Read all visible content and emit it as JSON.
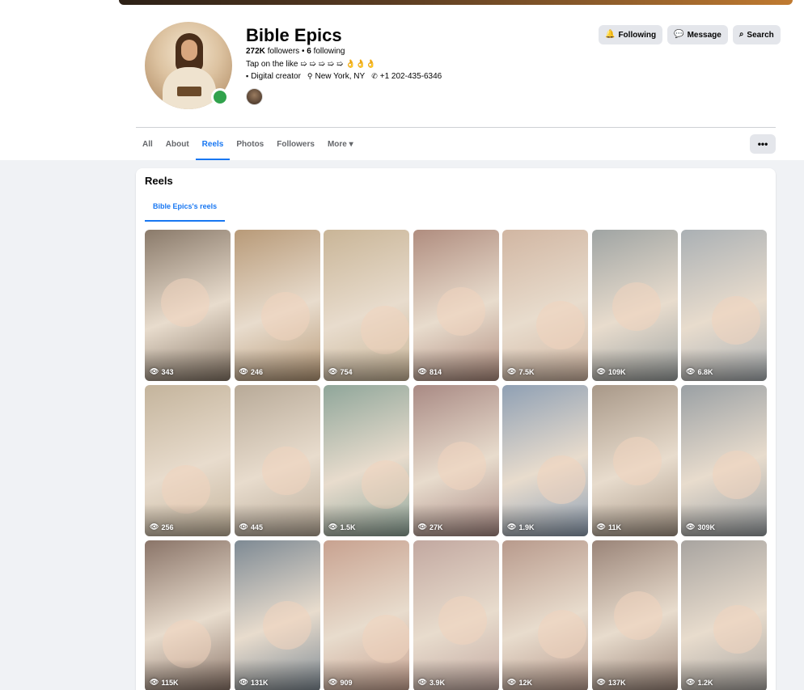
{
  "profile": {
    "name": "Bible Epics",
    "followers": "272K",
    "followers_label": "followers",
    "following": "6",
    "following_label": "following",
    "tagline": "Tap on the like ➯ ➯ ➯ ➯ ➯ 👌👌👌",
    "category": "Digital creator",
    "location": "New York, NY",
    "phone": "+1 202-435-6346"
  },
  "actions": {
    "following_label": "Following",
    "message_label": "Message",
    "search_label": "Search"
  },
  "tabs": [
    {
      "label": "All"
    },
    {
      "label": "About"
    },
    {
      "label": "Reels"
    },
    {
      "label": "Photos"
    },
    {
      "label": "Followers"
    },
    {
      "label": "More ▾"
    }
  ],
  "more_options_label": "•••",
  "reels": {
    "title": "Reels",
    "subtab": "Bible Epics's reels",
    "items": [
      {
        "views": "343",
        "color": "#8a7a6a"
      },
      {
        "views": "246",
        "color": "#b89a78"
      },
      {
        "views": "754",
        "color": "#c9b597"
      },
      {
        "views": "814",
        "color": "#b08d7f"
      },
      {
        "views": "7.5K",
        "color": "#d1b6a2"
      },
      {
        "views": "109K",
        "color": "#9fa4a3"
      },
      {
        "views": "6.8K",
        "color": "#aab0b4"
      },
      {
        "views": "256",
        "color": "#c4b49c"
      },
      {
        "views": "445",
        "color": "#b8aa98"
      },
      {
        "views": "1.5K",
        "color": "#8fa69a"
      },
      {
        "views": "27K",
        "color": "#a98a84"
      },
      {
        "views": "1.9K",
        "color": "#8fa0b4"
      },
      {
        "views": "11K",
        "color": "#a89888"
      },
      {
        "views": "309K",
        "color": "#9aa0a4"
      },
      {
        "views": "115K",
        "color": "#8a7468"
      },
      {
        "views": "131K",
        "color": "#7e8a94"
      },
      {
        "views": "909",
        "color": "#c8a290"
      },
      {
        "views": "3.9K",
        "color": "#c2a8a0"
      },
      {
        "views": "12K",
        "color": "#b89a8c"
      },
      {
        "views": "137K",
        "color": "#9a8478"
      },
      {
        "views": "1.2K",
        "color": "#a8a4a0"
      }
    ]
  }
}
